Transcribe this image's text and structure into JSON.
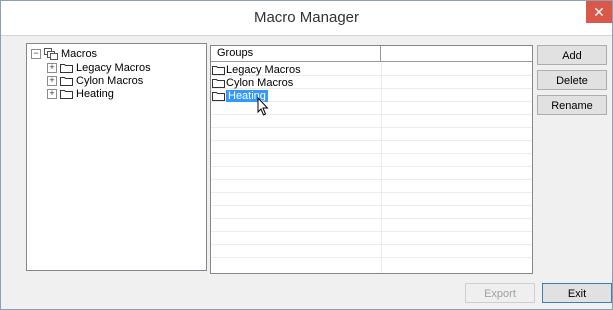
{
  "window": {
    "title": "Macro Manager",
    "close_glyph": "✕"
  },
  "tree": {
    "root": {
      "label": "Macros",
      "expander": "−",
      "icon": "macro-root-icon"
    },
    "children": [
      {
        "label": "Legacy Macros",
        "expander": "+"
      },
      {
        "label": "Cylon Macros",
        "expander": "+"
      },
      {
        "label": "Heating",
        "expander": "+"
      }
    ]
  },
  "grid": {
    "columns": [
      "Groups",
      ""
    ],
    "rows": [
      {
        "label": "Legacy Macros",
        "selected": false
      },
      {
        "label": "Cylon Macros",
        "selected": false
      },
      {
        "label": "Heating",
        "selected": true
      }
    ]
  },
  "buttons": {
    "add": "Add",
    "delete": "Delete",
    "rename": "Rename",
    "export": "Export",
    "exit": "Exit"
  },
  "colors": {
    "selection": "#3399ff",
    "close_button": "#d9584a"
  }
}
